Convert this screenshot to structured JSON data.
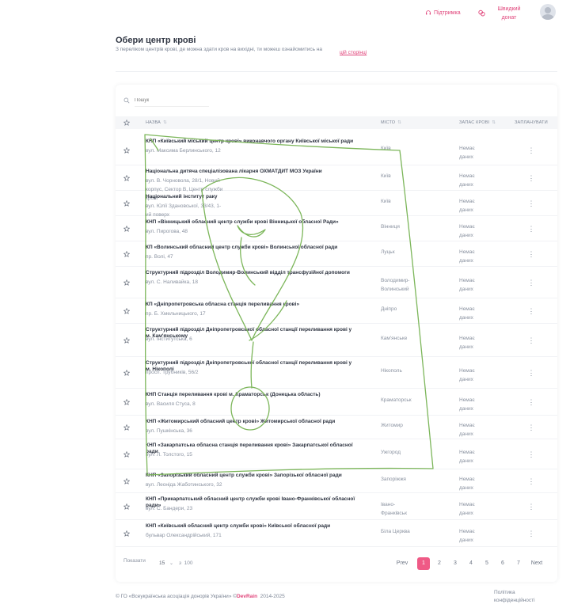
{
  "header": {
    "support_label": "Підтримка",
    "donate_label": "Швидкий донат"
  },
  "page": {
    "title": "Обери центр крові",
    "subtitle": "З переліком центрів крові, де можна здати кров на вихідні, ти можеш ознайомитись на",
    "subtitle_link": "цій сторінці"
  },
  "search": {
    "placeholder": "Пошук"
  },
  "table": {
    "columns": {
      "name": "НАЗВА",
      "city": "МІСТО",
      "stock": "ЗАПАС КРОВІ",
      "schedule": "ЗАПЛАНУВАТИ"
    },
    "rows": [
      {
        "name": "КНП «Київський міський центр крові» виконавчого органу Київської міської ради",
        "address": "вул. Максима Берлинського, 12",
        "city": "Київ",
        "stock": "Немає даних"
      },
      {
        "name": "Національна дитяча спеціалізована лікарня ОХМАТДИТ МОЗ України",
        "address": "вул. В. Чорновола, 28/1, Новий корпус, Сектор В, Центр служби крові",
        "city": "Київ",
        "stock": "Немає даних"
      },
      {
        "name": "Національний інститут раку",
        "address": "вул. Юлії Здановської, 33/43, 1-ий поверх",
        "city": "Київ",
        "stock": "Немає даних"
      },
      {
        "name": "КНП «Вінницький обласний центр служби крові Вінницької обласної Ради»",
        "address": "вул. Пирогова, 48",
        "city": "Вінниця",
        "stock": "Немає даних"
      },
      {
        "name": "КП «Волинський обласний центр служби крові» Волинської обласної ради",
        "address": "пр. Волі, 47",
        "city": "Луцьк",
        "stock": "Немає даних"
      },
      {
        "name": "Структурний підрозділ Володимир-Волинський відділ трансфузійної допомоги",
        "address": "вул. С. Наливайка, 18",
        "city": "Володимир-Волинський",
        "stock": "Немає даних"
      },
      {
        "name": "КП «Дніпропетровська обласна станція переливання крові»",
        "address": "пр. Б. Хмельницького, 17",
        "city": "Дніпро",
        "stock": "Немає даних"
      },
      {
        "name": "Структурний підрозділ Дніпропетровської обласної станції переливання крові у м. Кам'янському",
        "address": "вул. Інститутська, 6",
        "city": "Кам'янське",
        "stock": "Немає даних"
      },
      {
        "name": "Структурний підрозділ Дніпропетровської обласної станції переливання крові у м. Нікополі",
        "address": "просп. Трубників, 56/2",
        "city": "Нікополь",
        "stock": "Немає даних"
      },
      {
        "name": "КНП Станція переливання крові м. Краматорськ (Донецька область)",
        "address": "вул. Василя Стуса, 8",
        "city": "Краматорськ",
        "stock": "Немає даних"
      },
      {
        "name": "КНП «Житомирський обласний центр крові» Житомирської обласної ради",
        "address": "вул. Пушкінська, 36",
        "city": "Житомир",
        "stock": "Немає даних"
      },
      {
        "name": "КНП «Закарпатська обласна станція переливання крові» Закарпатської обласної ради",
        "address": "вул. Л. Толстого, 15",
        "city": "Ужгород",
        "stock": "Немає даних"
      },
      {
        "name": "КНП «Запорізький обласний центр служби крові» Запорізької обласної ради",
        "address": "вул. Леоніда Жаботинського, 32",
        "city": "Запоріжжя",
        "stock": "Немає даних"
      },
      {
        "name": "КНП «Прикарпатський обласний центр служби крові Івано-Франківської обласної ради»",
        "address": "вул. С. Бандери, 23",
        "city": "Івано-Франківськ",
        "stock": "Немає даних"
      },
      {
        "name": "КНП «Київський обласний центр служби крові» Київської обласної ради",
        "address": "бульвар Олександрійський, 171",
        "city": "Біла Церква",
        "stock": "Немає даних"
      }
    ]
  },
  "pagination": {
    "shown_label": "Показати",
    "page_size": "15",
    "of_label": "з",
    "total": "100",
    "prev": "Prev",
    "next": "Next",
    "pages": [
      "1",
      "2",
      "3",
      "4",
      "5",
      "6",
      "7"
    ],
    "current": "1"
  },
  "footer": {
    "copyright_prefix": "© ГО «Всеукраїнська асоціація донорів України» ©",
    "brand": "DevRain",
    "years": "2014-2025",
    "privacy": "Політика конфіденційності"
  },
  "colors": {
    "accent": "#e0447a",
    "scribble": "#7cb65a"
  }
}
